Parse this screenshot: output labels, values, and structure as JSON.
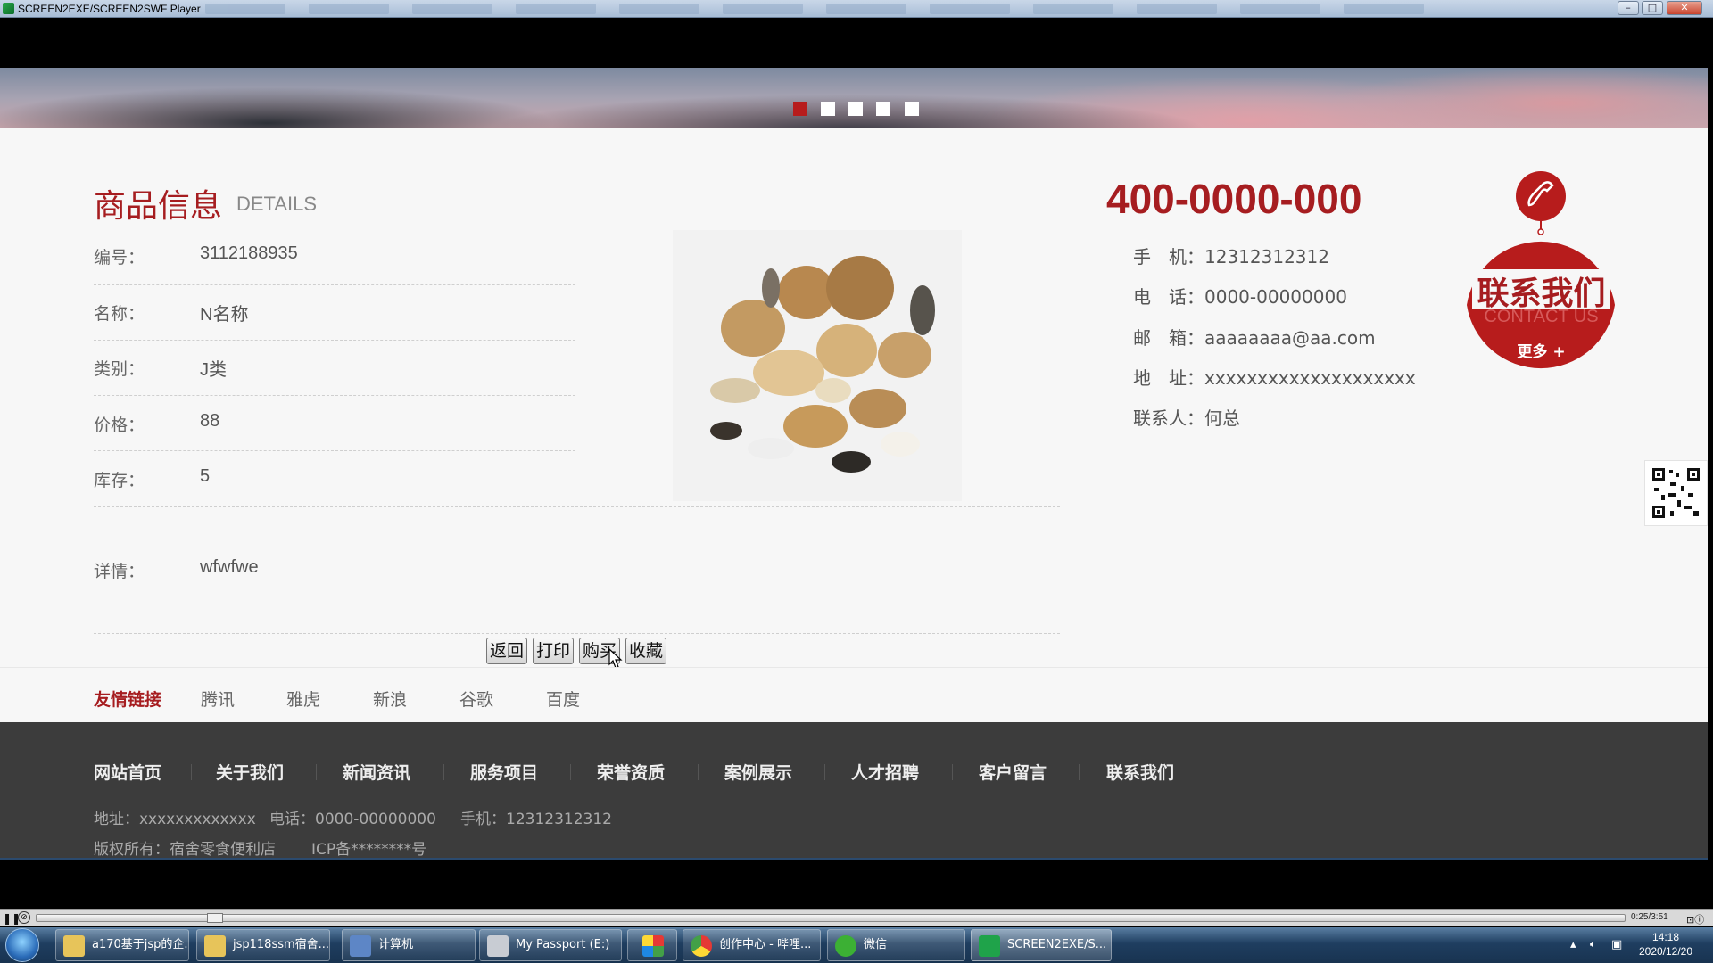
{
  "player": {
    "title": "SCREEN2EXE/SCREEN2SWF Player",
    "time": "0:25/3:51",
    "progress": 0.11
  },
  "banner": {
    "slide_count": 5,
    "active_slide": 1
  },
  "product": {
    "section_title": "商品信息",
    "section_subtitle": "DETAILS",
    "fields": [
      {
        "label": "编号：",
        "value": "3112188935"
      },
      {
        "label": "名称：",
        "value": "N名称"
      },
      {
        "label": "类别：",
        "value": "J类"
      },
      {
        "label": "价格：",
        "value": "88"
      },
      {
        "label": "库存：",
        "value": "5"
      }
    ],
    "detail_label": "详情：",
    "detail_value": "wfwfwe",
    "actions": [
      "返回",
      "打印",
      "购买",
      "收藏"
    ]
  },
  "contact": {
    "hotline": "400-0000-000",
    "mobile_label": "手　机：",
    "mobile": "12312312312",
    "phone_label": "电　话：",
    "phone": "0000-00000000",
    "email_label": "邮　箱：",
    "email": "aaaaaaaa@aa.com",
    "address_label": "地　址：",
    "address": "xxxxxxxxxxxxxxxxxxxx",
    "person_label": "联系人：",
    "person": "何总",
    "badge_title": "联系我们",
    "badge_en": "CONTACT US",
    "badge_more": "更多 +",
    "accent": "#a61d20"
  },
  "links": {
    "title": "友情链接",
    "items": [
      "腾讯",
      "雅虎",
      "新浪",
      "谷歌",
      "百度"
    ]
  },
  "footer": {
    "nav": [
      "网站首页",
      "关于我们",
      "新闻资讯",
      "服务项目",
      "荣誉资质",
      "案例展示",
      "人才招聘",
      "客户留言",
      "联系我们"
    ],
    "address": "地址：xxxxxxxxxxxxx",
    "phone": "电话：0000-00000000",
    "mobile": "手机：12312312312",
    "copyright": "版权所有：宿舍零食便利店",
    "icp": "ICP备********号"
  },
  "taskbar": {
    "tasks": [
      {
        "label": "a170基于jsp的企...",
        "icon": "folder-icon"
      },
      {
        "label": "jsp118ssm宿舍...",
        "icon": "folder-icon"
      },
      {
        "label": "计算机",
        "icon": "computer-icon"
      },
      {
        "label": "My Passport (E:)",
        "icon": "drive-icon"
      },
      {
        "label": "",
        "icon": "app-icon"
      },
      {
        "label": "创作中心 - 哔哩...",
        "icon": "chrome-icon"
      },
      {
        "label": "微信",
        "icon": "wechat-icon"
      },
      {
        "label": "SCREEN2EXE/S...",
        "icon": "screen2exe-icon"
      }
    ],
    "time": "14:18",
    "date": "2020/12/20"
  }
}
